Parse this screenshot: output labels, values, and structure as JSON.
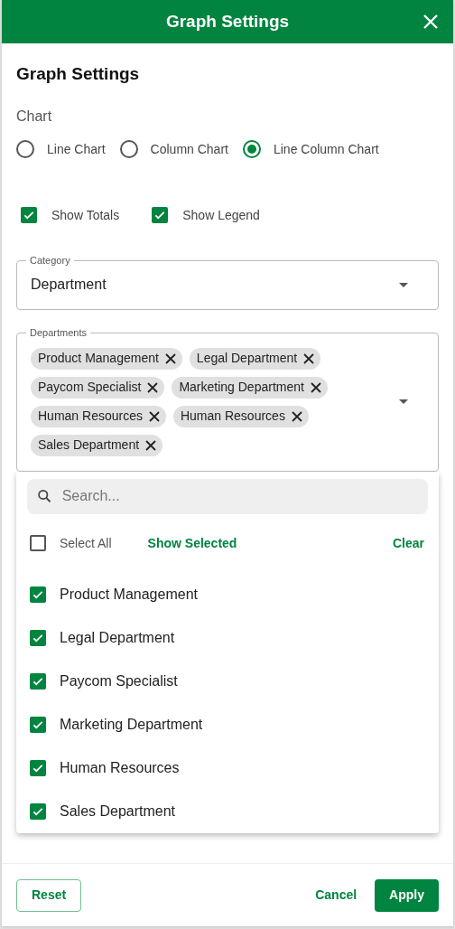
{
  "header": {
    "title": "Graph Settings"
  },
  "heading": "Graph Settings",
  "chart": {
    "label": "Chart",
    "options": [
      {
        "label": "Line Chart",
        "selected": false
      },
      {
        "label": "Column Chart",
        "selected": false
      },
      {
        "label": "Line Column Chart",
        "selected": true
      }
    ]
  },
  "toggles": [
    {
      "label": "Show Totals",
      "checked": true
    },
    {
      "label": "Show Legend",
      "checked": true
    }
  ],
  "category": {
    "label": "Category",
    "value": "Department"
  },
  "departments": {
    "label": "Departments",
    "chips": [
      "Product Management",
      "Legal Department",
      "Paycom Specialist",
      "Marketing Department",
      "Human Resources",
      "Human Resources",
      "Sales Department"
    ]
  },
  "popup": {
    "search": {
      "placeholder": "Search..."
    },
    "select_all": {
      "label": "Select All",
      "checked": false
    },
    "show_selected": "Show Selected",
    "clear": "Clear",
    "items": [
      {
        "label": "Product Management",
        "checked": true
      },
      {
        "label": "Legal Department",
        "checked": true
      },
      {
        "label": "Paycom Specialist",
        "checked": true
      },
      {
        "label": "Marketing Department",
        "checked": true
      },
      {
        "label": "Human Resources",
        "checked": true
      },
      {
        "label": "Sales Department",
        "checked": true
      }
    ]
  },
  "footer": {
    "reset": "Reset",
    "cancel": "Cancel",
    "apply": "Apply"
  }
}
